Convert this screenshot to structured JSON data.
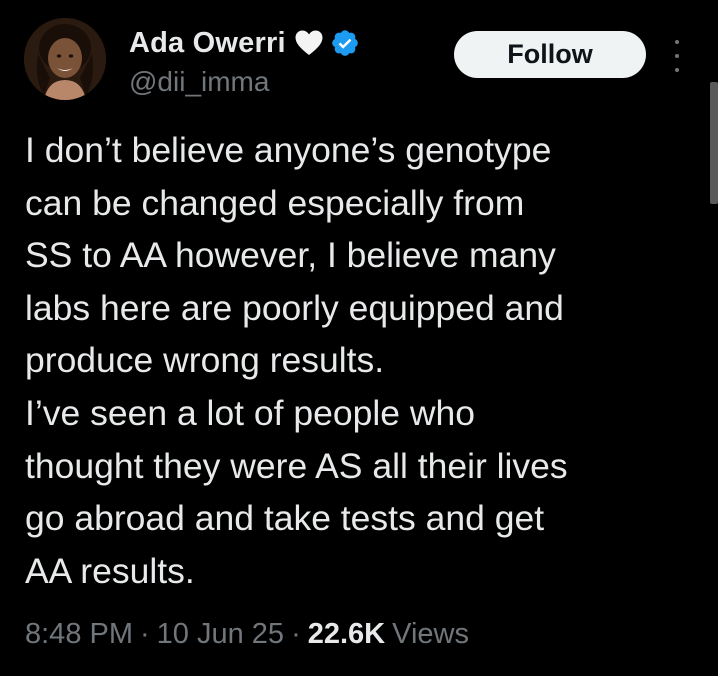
{
  "author": {
    "display_name": "Ada Owerri",
    "handle": "@dii_imma",
    "badge_icons": [
      "white-heart-icon",
      "verified-badge-icon"
    ],
    "verified_color": "#1d9bf0"
  },
  "actions": {
    "follow_label": "Follow",
    "more_icon": "more-vertical-icon"
  },
  "tweet": {
    "lines": [
      "I don’t believe anyone’s genotype",
      "can be changed especially from",
      "SS to AA however, I believe many",
      "labs here are poorly equipped and",
      "produce wrong results.",
      "I’ve seen a lot of people who",
      "thought they were AS all their lives",
      "go abroad and take tests and get",
      "AA results."
    ]
  },
  "meta": {
    "time": "8:48 PM",
    "separator": "·",
    "date": "10 Jun 25",
    "views_count": "22.6K",
    "views_label": "Views"
  },
  "colors": {
    "background": "#000000",
    "text_primary": "#e7e9ea",
    "text_secondary": "#71767b",
    "button_bg": "#eff3f4",
    "button_text": "#0f1419"
  }
}
